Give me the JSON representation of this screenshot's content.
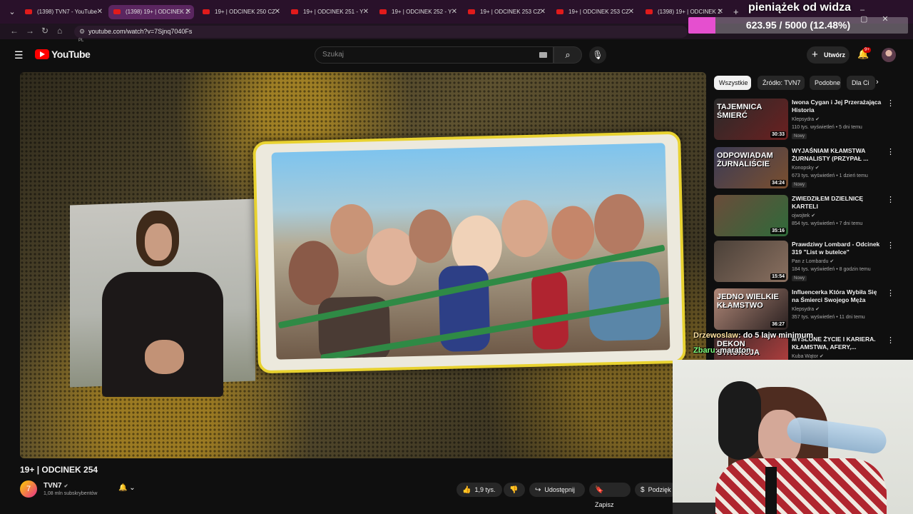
{
  "browser": {
    "tabs": [
      {
        "label": "(1398) TVN7 - YouTube",
        "active": false
      },
      {
        "label": "(1398) 19+ | ODCINEK 2",
        "active": true
      },
      {
        "label": "19+ | ODCINEK 250 CZ",
        "active": false
      },
      {
        "label": "19+ | ODCINEK 251 - Y",
        "active": false
      },
      {
        "label": "19+ | ODCINEK 252 - Y",
        "active": false
      },
      {
        "label": "19+ | ODCINEK 253 CZ",
        "active": false
      },
      {
        "label": "19+ | ODCINEK 253 CZ",
        "active": false
      },
      {
        "label": "(1398) 19+ | ODCINEK 2",
        "active": false
      }
    ],
    "url": "youtube.com/watch?v=7Sjnq7040Fs"
  },
  "donation": {
    "title": "pieniążek od widza",
    "progress_text": "623.95 / 5000 (12.48%)",
    "progress_fraction": 0.1248,
    "fill_color": "#e54fcf"
  },
  "youtube": {
    "logo_text": "YouTube",
    "logo_country": "PL",
    "search_placeholder": "Szukaj",
    "create_label": "Utwórz",
    "notif_badge": "9+"
  },
  "video": {
    "title": "19+ | ODCINEK 254",
    "channel_name": "TVN7",
    "channel_avatar_letter": "7",
    "subscribers": "1,08 mln subskrybentów",
    "likes": "1,9 tys.",
    "share_label": "Udostępnij",
    "save_label": "Zapisz",
    "thanks_label": "Podzięk"
  },
  "sidebar": {
    "chips": [
      "Wszystkie",
      "Źródło: TVN7",
      "Podobne",
      "Dla Ci"
    ],
    "recommendations": [
      {
        "title": "Iwona Cygan i Jej Przerażająca Historia",
        "channel": "Klepsydra",
        "meta": "110 tys. wyświetleń • 5 dni temu",
        "badge": "Nowy",
        "duration": "30:33",
        "thumb_text": "TAJEMNICA ŚMIERĆ"
      },
      {
        "title": "WYJAŚNIAM KŁAMSTWA ŻURNALISTY (PRZYPAŁ ...",
        "channel": "Konopsky",
        "meta": "673 tys. wyświetleń • 1 dzień temu",
        "badge": "Nowy",
        "duration": "34:24",
        "thumb_text": "ODPOWIADAM ŻURNALIŚCIE"
      },
      {
        "title": "ZWIEDZIŁEM DZIELNICĘ KARTELI",
        "channel": "ojwojtek",
        "meta": "854 tys. wyświetleń • 7 dni temu",
        "badge": "",
        "duration": "35:16",
        "thumb_text": ""
      },
      {
        "title": "Prawdziwy Lombard - Odcinek 319 \"List w butelce\"",
        "channel": "Pan z Lombardu",
        "meta": "184 tys. wyświetleń • 8 godzin temu",
        "badge": "Nowy",
        "duration": "15:54",
        "thumb_text": ""
      },
      {
        "title": "Influencerka Która Wybiła Się na Śmierci Swojego Męża",
        "channel": "Klepsydra",
        "meta": "357 tys. wyświetleń • 11 dni temu",
        "badge": "",
        "duration": "36:27",
        "thumb_text": "JEDNO WIELKIE KŁAMSTWO"
      },
      {
        "title": "MYSLONE ŻYCIE I KARIERA. KŁAMSTWA, AFERY,...",
        "channel": "Kuba Wątor",
        "meta": "",
        "badge": "",
        "duration": "",
        "thumb_text": "DEKON STRUKCJA"
      }
    ]
  },
  "chat": [
    {
      "user": "Drzewoslaw",
      "message": ": do 5 lajw minimum"
    },
    {
      "user": "Zbaru",
      "message": ": maraton"
    }
  ]
}
